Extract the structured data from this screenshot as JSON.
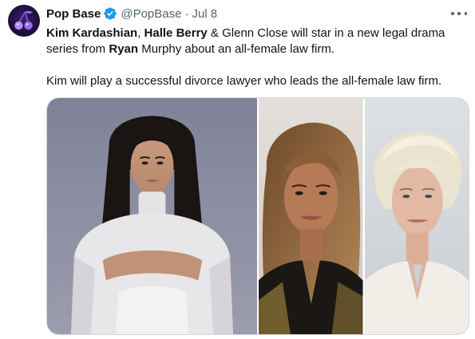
{
  "tweet": {
    "author": {
      "display_name": "Pop Base",
      "verified": true,
      "handle": "@PopBase",
      "separator": "·",
      "timestamp": "Jul 8",
      "avatar_icon": "purple-cherry-logo"
    },
    "more_icon": "ellipsis-icon",
    "text": {
      "para1": {
        "bold1": "Kim Kardashian",
        "plain1": ", ",
        "bold2": "Halle Berry",
        "plain2": " & Glenn Close will star in a new legal drama series from ",
        "bold3": "Ryan",
        "plain3": " Murphy about an all-female law firm."
      },
      "para2": "Kim will play a successful divorce lawyer who leads the all-female law firm."
    },
    "media": {
      "photos": [
        {
          "subject": "Kim Kardashian",
          "background": "#8b8ea3",
          "outfit": "#e7e6e8"
        },
        {
          "subject": "Halle Berry",
          "background": "#d9d4cf",
          "outfit": "#1b1714"
        },
        {
          "subject": "Glenn Close",
          "background": "#d4d8dc",
          "outfit": "#f1ede7"
        }
      ]
    }
  },
  "colors": {
    "text_primary": "#0f1419",
    "text_secondary": "#536471",
    "verified_blue": "#1d9bf0",
    "media_border": "#cfd9de"
  }
}
